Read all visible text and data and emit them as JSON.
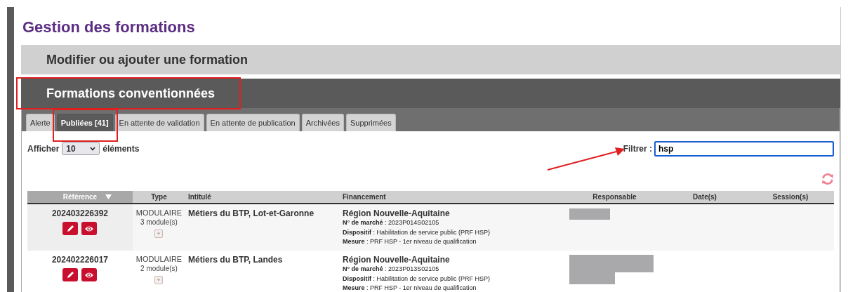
{
  "page_title": "Gestion des formations",
  "sections": [
    {
      "title": "Modifier ou ajouter une formation",
      "expanded": false
    },
    {
      "title": "Formations conventionnées",
      "expanded": true
    }
  ],
  "tabs": [
    {
      "label": "Alerte",
      "selected": false
    },
    {
      "label": "Publiées [41]",
      "selected": true
    },
    {
      "label": "En attente de validation",
      "selected": false
    },
    {
      "label": "En attente de publication",
      "selected": false
    },
    {
      "label": "Archivées",
      "selected": false
    },
    {
      "label": "Supprimées",
      "selected": false
    }
  ],
  "page_length": {
    "label_before": "Afficher",
    "value": "10",
    "label_after": "éléments"
  },
  "filter": {
    "label": "Filtrer :",
    "value": "hsp"
  },
  "table": {
    "columns": [
      {
        "label": "Référence",
        "sorted": true
      },
      {
        "label": "Type",
        "sorted": false
      },
      {
        "label": "Intitulé",
        "sorted": false
      },
      {
        "label": "Financement",
        "sorted": false
      },
      {
        "label": "Responsable",
        "sorted": false
      },
      {
        "label": "Date(s)",
        "sorted": false
      },
      {
        "label": "Session(s)",
        "sorted": false
      }
    ],
    "rows": [
      {
        "reference": "202403226392",
        "type": "MODULAIRE",
        "modules": "3 module(s)",
        "title": "Métiers du BTP, Lot-et-Garonne",
        "funder": "Région Nouvelle-Aquitaine",
        "details": [
          "**N° de marché** : 2023P014S02105",
          "**Dispositif** : Habilitation de service public (PRF HSP)",
          "**Mesure** : PRF HSP - 1er niveau de qualification"
        ]
      },
      {
        "reference": "202402226017",
        "type": "MODULAIRE",
        "modules": "2 module(s)",
        "title": "Métiers du BTP, Landes",
        "funder": "Région Nouvelle-Aquitaine",
        "details": [
          "**N° de marché** : 2023P013S02105",
          "**Dispositif** : Habilitation de service public (PRF HSP)",
          "**Mesure** : PRF HSP - 1er niveau de qualification"
        ]
      }
    ]
  }
}
